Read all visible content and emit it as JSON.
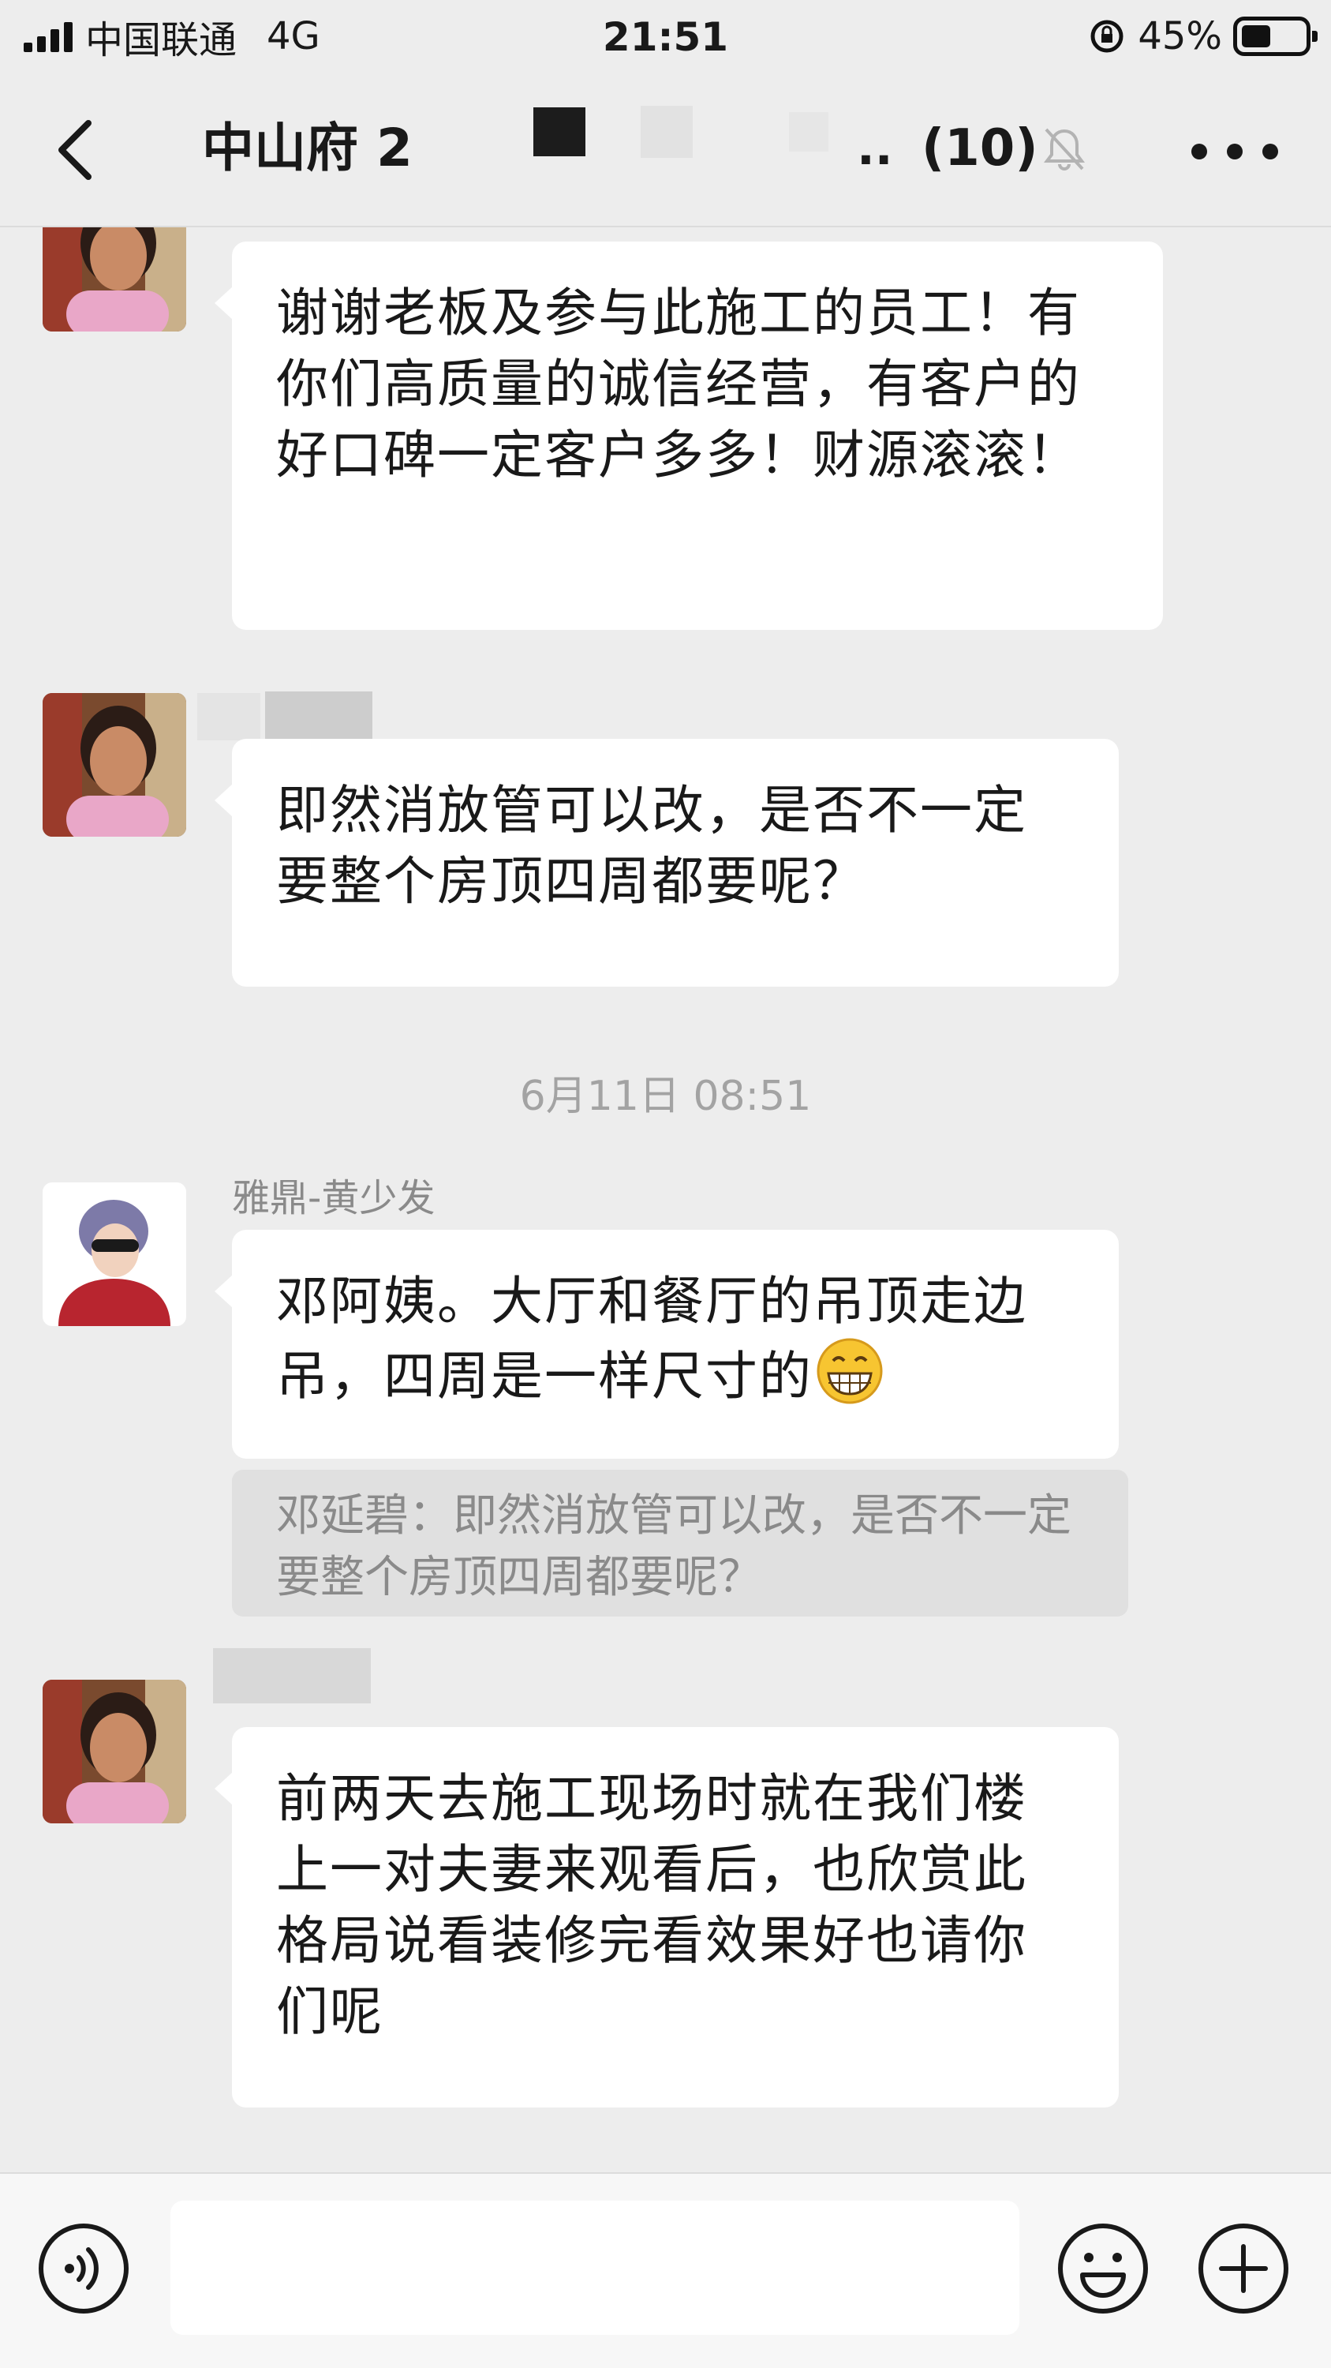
{
  "status_bar": {
    "carrier": "中国联通",
    "network": "4G",
    "time": "21:51",
    "battery": "45%"
  },
  "header": {
    "title": "中山府 2",
    "ellipsis": "..",
    "member_count": "(10)"
  },
  "messages": [
    {
      "text": "谢谢老板及参与此施工的员工！有你们高质量的诚信经营，有客户的好口碑一定客户多多！财源滚滚！"
    },
    {
      "text": "即然消放管可以改，是否不一定要整个房顶四周都要呢？"
    },
    {
      "timestamp": "6月11日 08:51"
    },
    {
      "sender": "雅鼎-黄少发",
      "text": "邓阿姨。大厅和餐厅的吊顶走边吊，四周是一样尺寸的",
      "quote": "邓延碧：即然消放管可以改，是否不一定要整个房顶四周都要呢？"
    },
    {
      "text": "前两天去施工现场时就在我们楼上一对夫妻来观看后，也欣赏此格局说看装修完看效果好也请你们呢"
    }
  ],
  "input_bar": {
    "placeholder": ""
  },
  "icons": [
    "back-icon",
    "mute-bell-icon",
    "more-icon",
    "voice-icon",
    "emoji-icon",
    "plus-icon",
    "grinning-emoji"
  ]
}
